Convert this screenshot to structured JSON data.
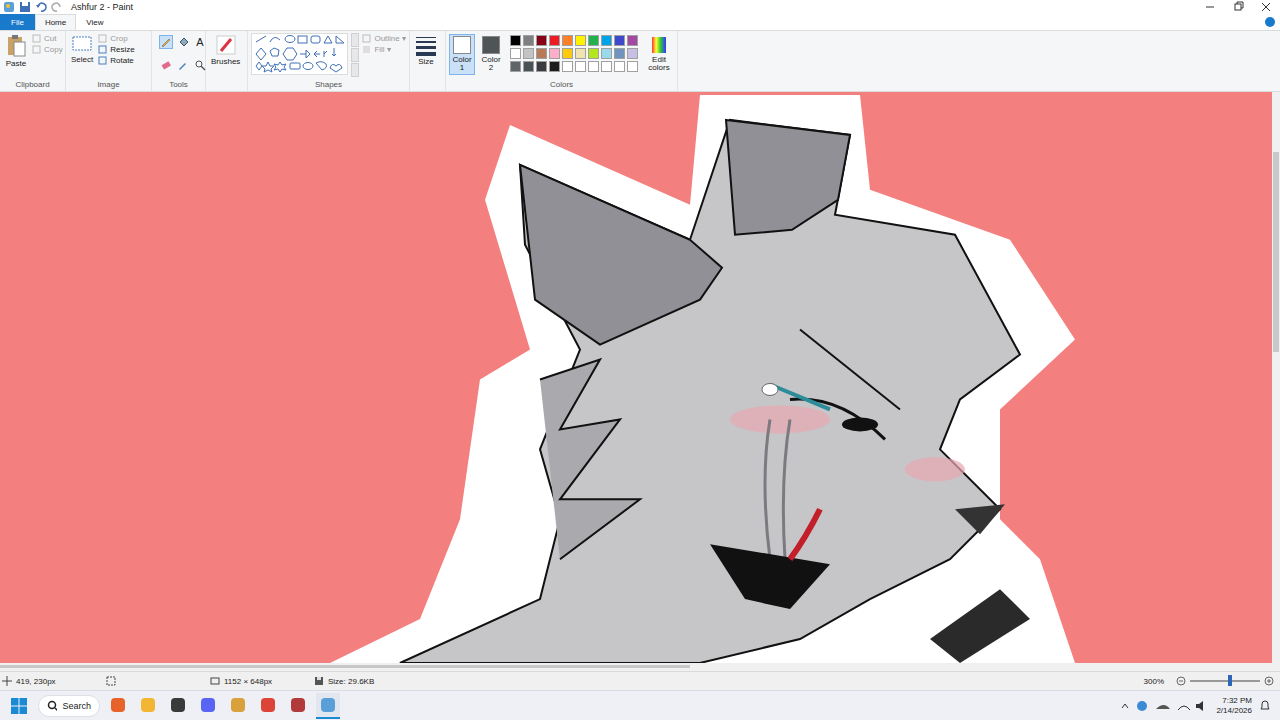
{
  "window": {
    "title": "Ashfur 2 - Paint"
  },
  "tabs": [
    {
      "label": "File",
      "selected": false,
      "kind": "file"
    },
    {
      "label": "Home",
      "selected": true,
      "kind": "tab"
    },
    {
      "label": "View",
      "selected": false,
      "kind": "tab"
    }
  ],
  "ribbon": {
    "clipboard": {
      "label": "Clipboard",
      "paste": "Paste",
      "buttons": [
        {
          "label": "Cut",
          "disabled": true
        },
        {
          "label": "Copy",
          "disabled": true
        }
      ]
    },
    "image": {
      "label": "Image",
      "select": "Select",
      "buttons": [
        {
          "label": "Crop",
          "disabled": true
        },
        {
          "label": "Resize",
          "disabled": false
        },
        {
          "label": "Rotate",
          "disabled": false
        }
      ]
    },
    "tools": {
      "label": "Tools",
      "items": [
        {
          "kind": "pencil",
          "glyph": "",
          "selected": true
        },
        {
          "kind": "fill",
          "glyph": "",
          "selected": false
        },
        {
          "kind": "text",
          "glyph": "A",
          "selected": false
        },
        {
          "kind": "eraser",
          "glyph": "",
          "selected": false
        },
        {
          "kind": "picker",
          "glyph": "",
          "selected": false
        },
        {
          "kind": "magnifier",
          "glyph": "",
          "selected": false
        }
      ]
    },
    "brushes": {
      "label": "Brushes"
    },
    "shapes": {
      "label": "Shapes",
      "outline": {
        "label": "Outline",
        "disabled": true
      },
      "fill": {
        "label": "Fill",
        "disabled": true
      }
    },
    "size": {
      "label": "Size"
    },
    "colors": {
      "label": "Colors",
      "color1": {
        "label": "Color 1",
        "color": "#ffffff",
        "selected": true
      },
      "color2": {
        "label": "Color 2",
        "color": "#4f5456",
        "selected": false
      },
      "palette": [
        {
          "color": "#000000"
        },
        {
          "color": "#7f7f7f"
        },
        {
          "color": "#880015"
        },
        {
          "color": "#ed1c24"
        },
        {
          "color": "#ff7f27"
        },
        {
          "color": "#fff200"
        },
        {
          "color": "#22b14c"
        },
        {
          "color": "#00a2e8"
        },
        {
          "color": "#3f48cc"
        },
        {
          "color": "#a349a4"
        },
        {
          "color": "#ffffff"
        },
        {
          "color": "#c3c3c3"
        },
        {
          "color": "#b97a57"
        },
        {
          "color": "#ffaec9"
        },
        {
          "color": "#ffc90e"
        },
        {
          "color": "#efe4b0"
        },
        {
          "color": "#b5e61d"
        },
        {
          "color": "#99d9ea"
        },
        {
          "color": "#7092be"
        },
        {
          "color": "#c8bfe7"
        },
        {
          "color": "#5f6466"
        },
        {
          "color": "#4a5256"
        },
        {
          "color": "#3a3d40"
        },
        {
          "color": "#1c1c1c"
        },
        {
          "color": "#ffffff"
        },
        {
          "color": "#ffffff"
        },
        {
          "color": "#ffffff"
        },
        {
          "color": "#ffffff"
        },
        {
          "color": "#ffffff"
        },
        {
          "color": "#ffffff"
        }
      ],
      "edit": "Edit colors"
    }
  },
  "status_bar": {
    "cursor": "419, 230px",
    "dimensions": "1152 × 648px",
    "size": "Size: 29.6KB",
    "zoom": "300%",
    "zoom_level": 0.57
  },
  "taskbar": {
    "search": "Search",
    "time": "7:32 PM",
    "date": "2/14/2026",
    "apps": [
      {
        "kind": "firefox",
        "running": false
      },
      {
        "kind": "explorer",
        "running": false
      },
      {
        "kind": "chat",
        "running": false
      },
      {
        "kind": "discord",
        "running": false
      },
      {
        "kind": "folder",
        "running": false
      },
      {
        "kind": "chrome",
        "running": false
      },
      {
        "kind": "game",
        "running": false
      },
      {
        "kind": "paint",
        "running": true
      }
    ]
  }
}
